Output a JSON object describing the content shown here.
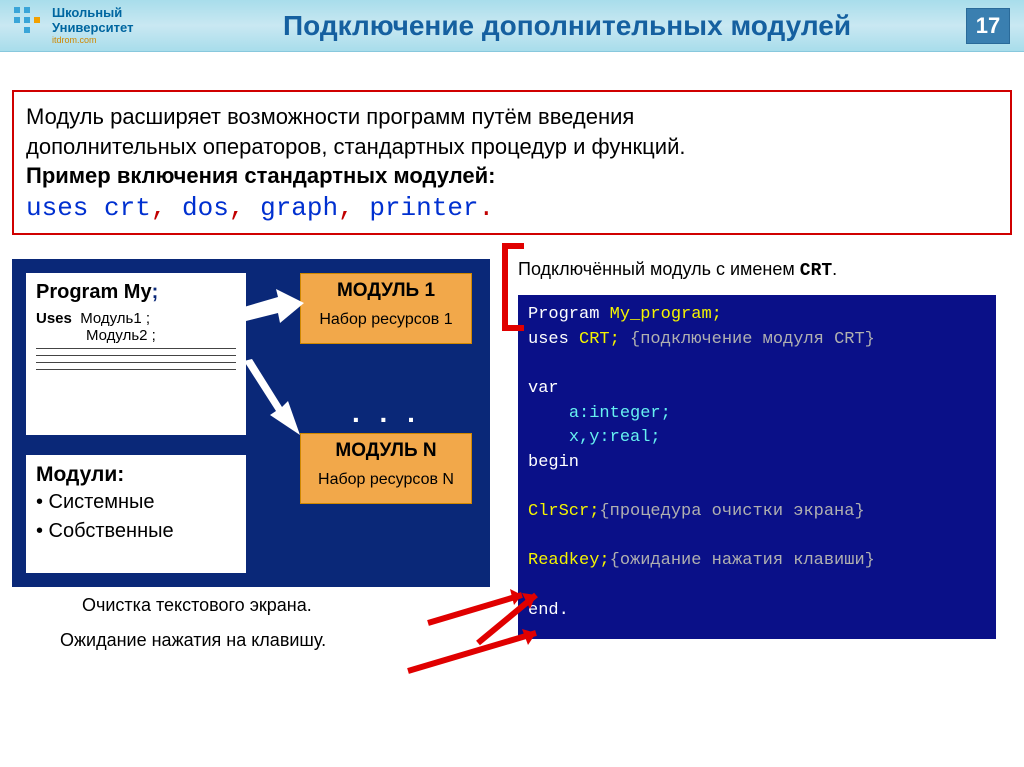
{
  "header": {
    "logo_line1": "Школьный",
    "logo_line2": "Университет",
    "logo_sub": "itdrom.com",
    "title": "Подключение дополнительных модулей",
    "page_number": "17"
  },
  "infobox": {
    "line1": "Модуль расширяет возможности программ путём введения",
    "line2": "дополнительных операторов, стандартных процедур и функций.",
    "line3_bold": "Пример включения стандартных модулей:",
    "code_kw": "uses",
    "code_args": " crt",
    "code_c1": ",",
    "code_a2": " dos",
    "code_c2": ",",
    "code_a3": " graph",
    "code_c3": ",",
    "code_a4": " printer",
    "code_dot": "."
  },
  "diagram": {
    "program_title": "Program My",
    "semicolon": ";",
    "uses_kw": "Uses",
    "uses_mod1": "Модуль1 ;",
    "uses_mod2": "Модуль2 ;",
    "module1_title": "МОДУЛЬ 1",
    "module1_sub": "Набор ресурсов 1",
    "moduleN_title": "МОДУЛЬ N",
    "moduleN_sub": "Набор ресурсов N",
    "dots": ". . .",
    "types_title": "Модули:",
    "types_item1": "• Системные",
    "types_item2": "• Собственные"
  },
  "captions": {
    "c1": "Очистка текстового экрана.",
    "c2": "Ожидание нажатия на клавишу."
  },
  "right": {
    "callout": "Подключённый модуль с именем ",
    "callout_name": "CRT",
    "callout_dot": ".",
    "code": {
      "l1a": "Program ",
      "l1b": "My_program;",
      "l2a": "uses ",
      "l2b": "CRT; ",
      "l2c": "{подключение модуля CRT}",
      "l3": "var",
      "l4": "a:integer;",
      "l5": "x,y:real;",
      "l6": "begin",
      "l7a": "ClrScr;",
      "l7b": "{процедура очистки экрана}",
      "l8a": "Readkey;",
      "l8b": "{ожидание нажатия клавиши}",
      "l9": "end."
    }
  }
}
